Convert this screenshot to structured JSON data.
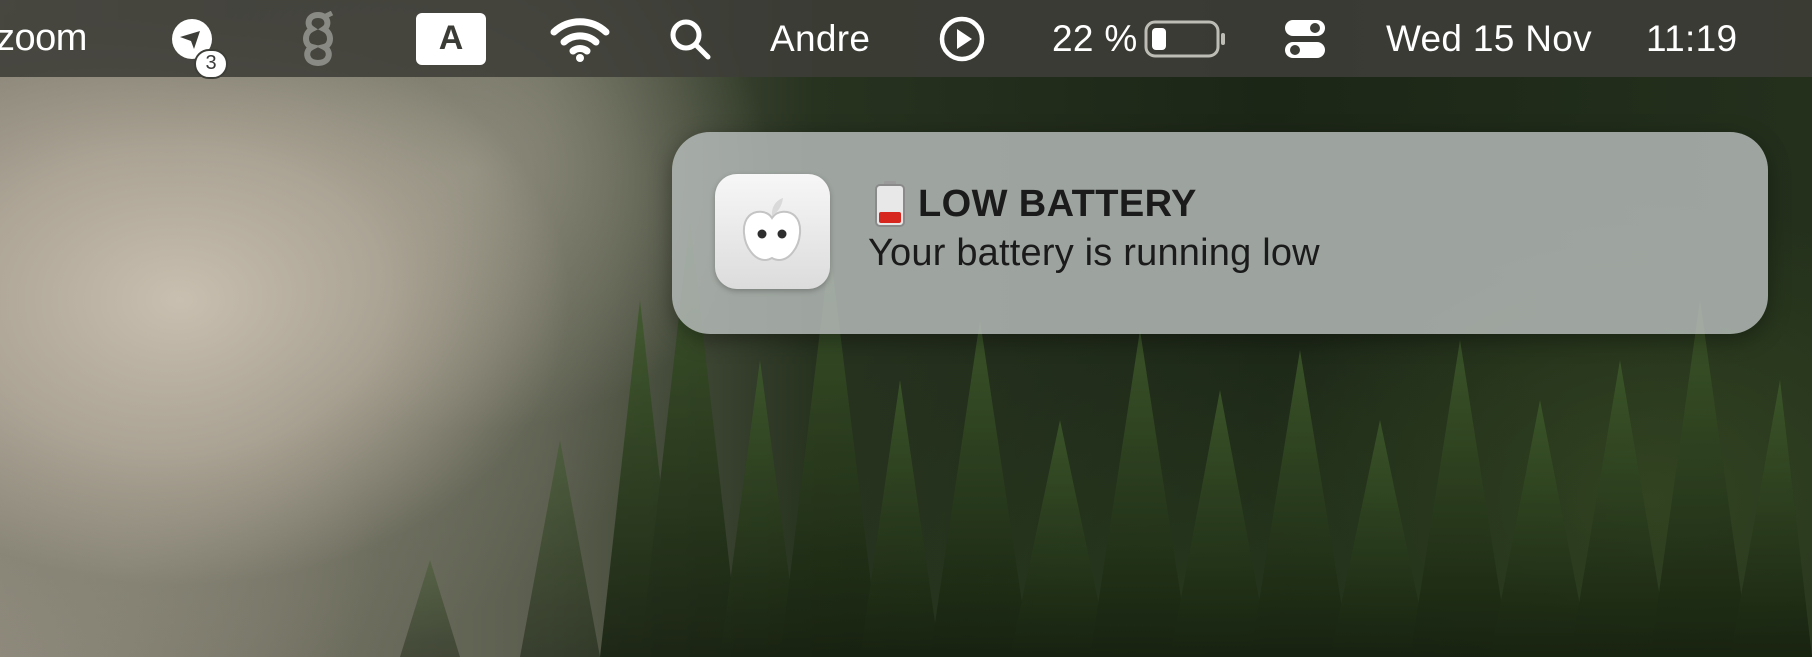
{
  "menubar": {
    "app_name": "zoom",
    "notification_count": "3",
    "input_source": "A",
    "user": "Andre",
    "battery_percent": "22 %",
    "battery_level": 0.22,
    "date": "Wed 15 Nov",
    "time": "11:19",
    "icons": [
      "pin-badge-icon",
      "g-app-icon",
      "input-source-icon",
      "wifi-icon",
      "search-icon",
      "play-circle-icon",
      "battery-icon",
      "control-center-icon"
    ]
  },
  "notification": {
    "app_icon": "power-outlet-icon",
    "title_icon": "low-battery-icon",
    "title": "LOW BATTERY",
    "body": "Your battery is running low",
    "colors": {
      "background": "#b2b8b6",
      "battery_red": "#d7261e"
    }
  }
}
